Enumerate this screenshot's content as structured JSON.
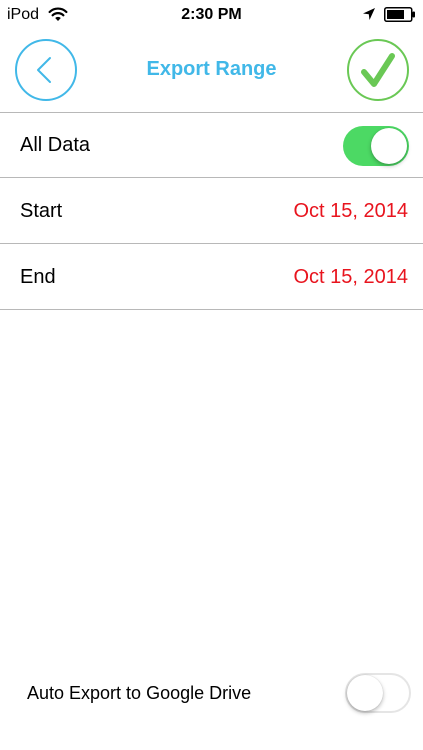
{
  "status_bar": {
    "carrier": "iPod",
    "time": "2:30 PM",
    "icons": [
      "wifi-icon",
      "location-arrow-icon",
      "battery-icon"
    ]
  },
  "nav": {
    "title": "Export Range",
    "back_icon": "chevron-left-icon",
    "done_icon": "checkmark-icon"
  },
  "rows": {
    "all_data": {
      "label": "All Data",
      "toggle_on": true
    },
    "start": {
      "label": "Start",
      "value": "Oct 15, 2014"
    },
    "end": {
      "label": "End",
      "value": "Oct 15, 2014"
    }
  },
  "footer": {
    "auto_export_label": "Auto Export to Google Drive",
    "toggle_on": false
  },
  "colors": {
    "accent_blue": "#41b8e8",
    "accent_green": "#6ac855",
    "toggle_on_green": "#4cd964",
    "date_red": "#e8141e",
    "divider": "#b8b8b8"
  }
}
